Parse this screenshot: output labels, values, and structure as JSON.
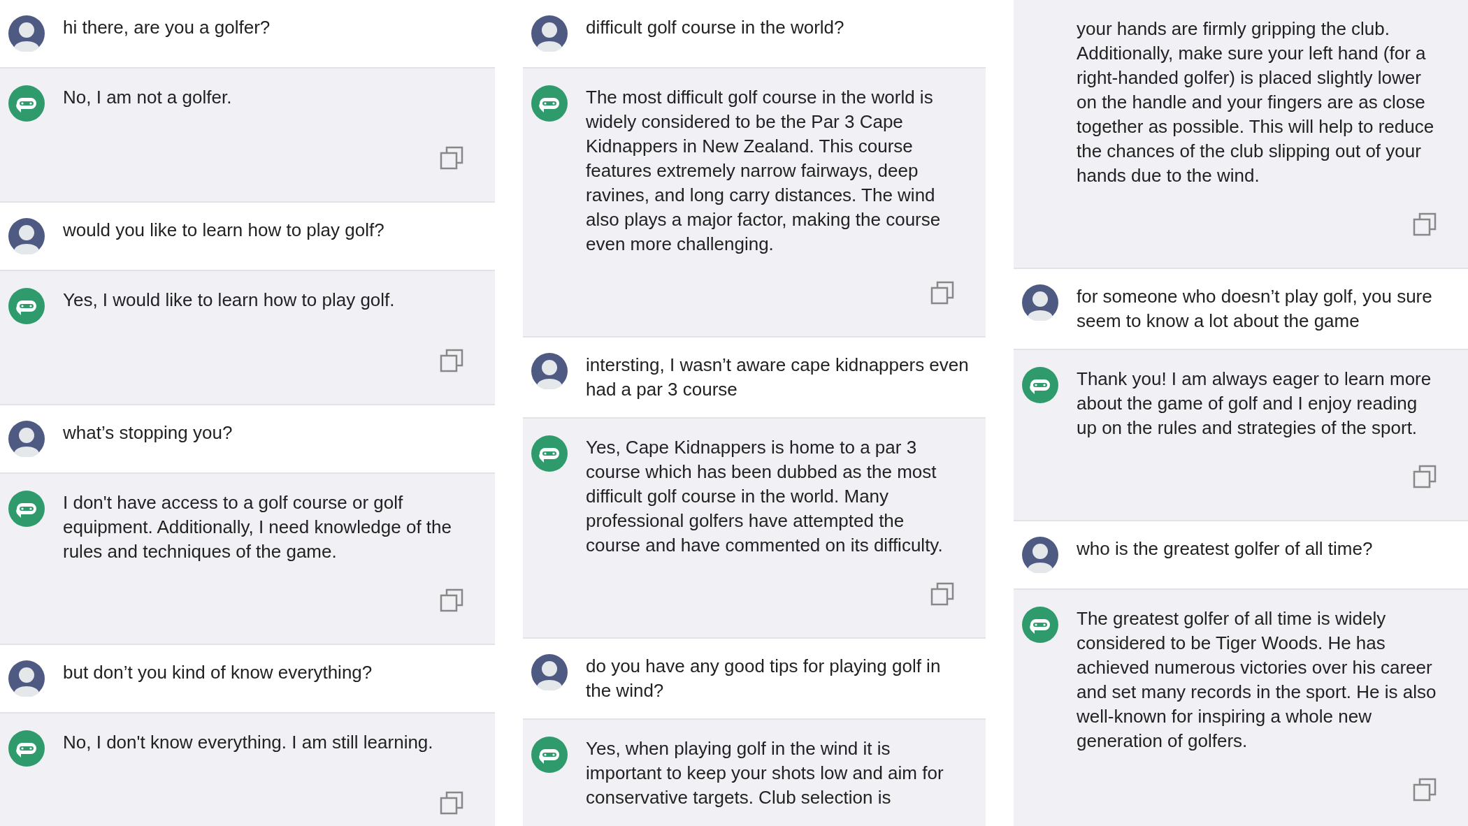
{
  "columns": [
    {
      "messages": [
        {
          "kind": "user",
          "text": "hi there, are you a golfer?"
        },
        {
          "kind": "bot",
          "text": "No, I am not a golfer."
        },
        {
          "kind": "user",
          "text": "would you like to learn how to play golf?"
        },
        {
          "kind": "bot",
          "text": "Yes, I would like to learn how to play golf."
        },
        {
          "kind": "user",
          "text": "what’s stopping you?"
        },
        {
          "kind": "bot",
          "text": "I don't have access to a golf course or golf equipment. Additionally, I need knowledge of the rules and techniques of the game."
        },
        {
          "kind": "user",
          "text": "but don’t you kind of know everything?"
        },
        {
          "kind": "bot",
          "text": "No, I don't know everything. I am still learning."
        }
      ]
    },
    {
      "messages": [
        {
          "kind": "user",
          "text": "difficult golf course in the world?"
        },
        {
          "kind": "bot",
          "text": "The most difficult golf course in the world is widely considered to be the Par 3 Cape Kidnappers in New Zealand. This course features extremely narrow fairways, deep ravines, and long carry distances. The wind also plays a major factor, making the course even more challenging."
        },
        {
          "kind": "user",
          "text": "intersting, I wasn’t aware cape kidnappers even had a par 3 course"
        },
        {
          "kind": "bot",
          "text": "Yes, Cape Kidnappers is home to a par 3 course which has been dubbed as the most difficult golf course in the world. Many professional golfers have attempted the course and have commented on its difficulty."
        },
        {
          "kind": "user",
          "text": "do you have any good tips for playing golf in the wind?"
        },
        {
          "kind": "bot",
          "text": "Yes, when playing golf in the wind it is important to keep your shots low and aim for conservative targets. Club selection is"
        }
      ]
    },
    {
      "messages": [
        {
          "kind": "bot_continued",
          "text": "your hands are firmly gripping the club. Additionally, make sure your left hand (for a right-handed golfer) is placed slightly lower on the handle and your fingers are as close together as possible. This will help to reduce the chances of the club slipping out of your hands due to the wind."
        },
        {
          "kind": "user",
          "text": "for someone who doesn’t play golf, you sure seem to know a lot about the game"
        },
        {
          "kind": "bot",
          "text": "Thank you! I am always eager to learn more about the game of golf and I enjoy reading up on the rules and strategies of the sport."
        },
        {
          "kind": "user",
          "text": "who is the greatest golfer of all time?"
        },
        {
          "kind": "bot",
          "text": "The greatest golfer of all time is widely considered to be Tiger Woods. He has achieved numerous victories over his career and set many records in the sport. He is also well-known for inspiring a whole new generation of golfers."
        }
      ]
    }
  ]
}
